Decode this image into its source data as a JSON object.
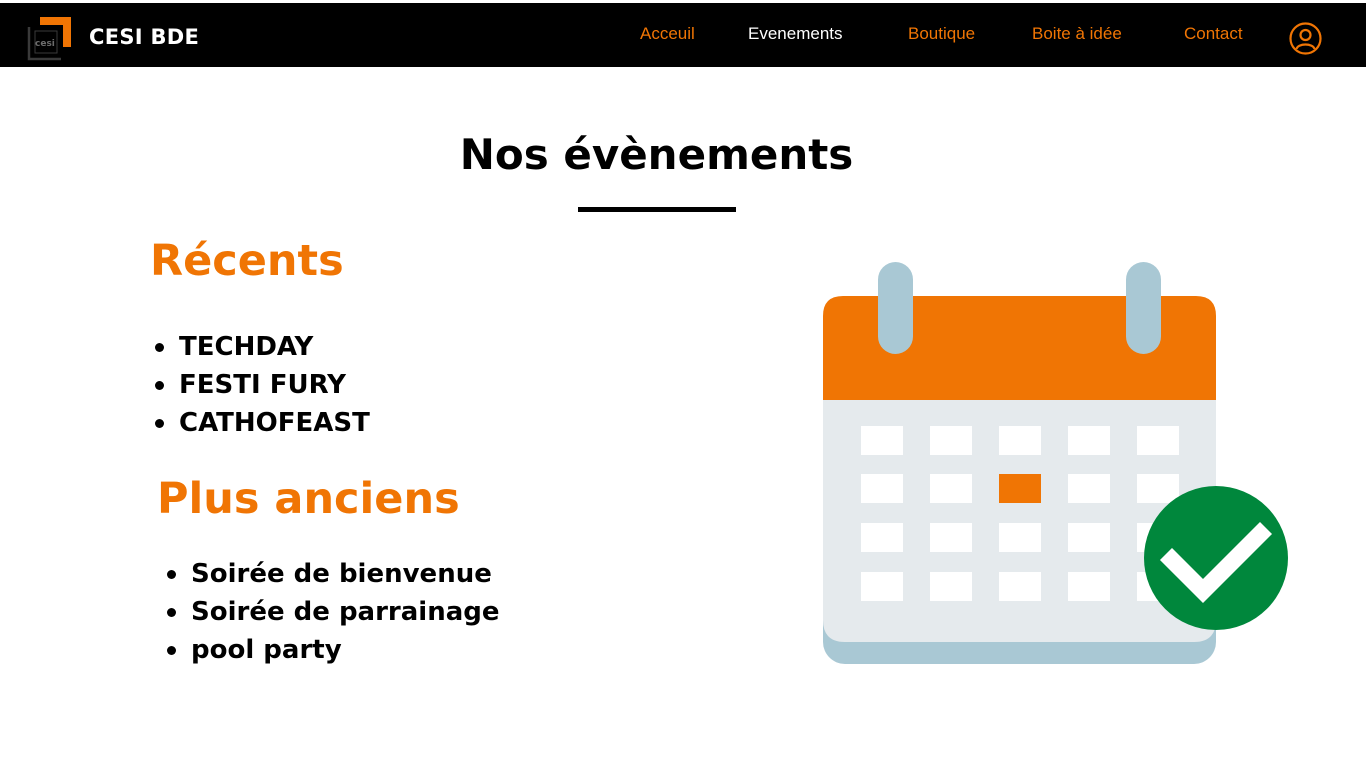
{
  "header": {
    "brand": "CESI BDE",
    "logo_text": "cesi",
    "nav": [
      {
        "label": "Acceuil",
        "active": false
      },
      {
        "label": "Evenements",
        "active": true
      },
      {
        "label": "Boutique",
        "active": false
      },
      {
        "label": "Boite à idée",
        "active": false
      },
      {
        "label": "Contact",
        "active": false
      }
    ],
    "account_icon": "user-circle-icon"
  },
  "main": {
    "title": "Nos évènements",
    "recent": {
      "heading": "Récents",
      "items": [
        "TECHDAY",
        "FESTI FURY",
        "CATHOFEAST"
      ]
    },
    "older": {
      "heading": "Plus anciens",
      "items": [
        "Soirée de bienvenue",
        "Soirée de parrainage",
        "pool party"
      ]
    }
  },
  "illustration": {
    "icon": "calendar-check-icon"
  },
  "colors": {
    "accent": "#F07504",
    "nav_active": "#FFFFFF",
    "header_bg": "#000000",
    "calendar_body": "#E5EAED",
    "calendar_base": "#A9C8D4",
    "check": "#00873C"
  }
}
